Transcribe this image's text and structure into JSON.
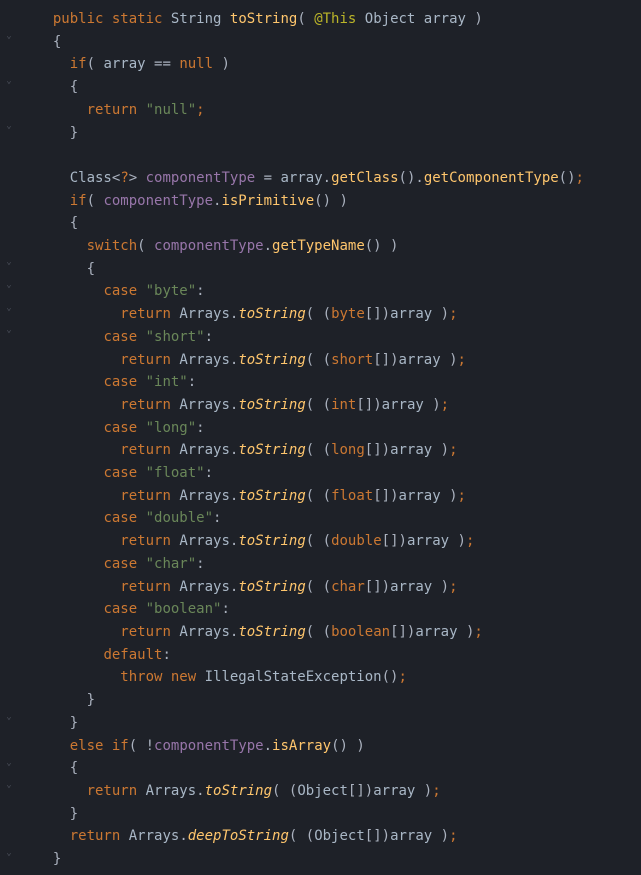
{
  "code": {
    "lines": [
      {
        "indent": 1,
        "tokens": [
          {
            "t": "public ",
            "c": "kw-orange"
          },
          {
            "t": "static ",
            "c": "kw-orange"
          },
          {
            "t": "String ",
            "c": "class-name"
          },
          {
            "t": "toString",
            "c": "method"
          },
          {
            "t": "( ",
            "c": "white"
          },
          {
            "t": "@This ",
            "c": "anno"
          },
          {
            "t": "Object ",
            "c": "class-name"
          },
          {
            "t": "array ",
            "c": "param"
          },
          {
            "t": ")",
            "c": "white"
          }
        ]
      },
      {
        "indent": 1,
        "tokens": [
          {
            "t": "{",
            "c": "white"
          }
        ]
      },
      {
        "indent": 2,
        "tokens": [
          {
            "t": "if",
            "c": "kw-orange"
          },
          {
            "t": "( ",
            "c": "white"
          },
          {
            "t": "array ",
            "c": "param"
          },
          {
            "t": "== ",
            "c": "white"
          },
          {
            "t": "null ",
            "c": "kw-orange"
          },
          {
            "t": ")",
            "c": "white"
          }
        ]
      },
      {
        "indent": 2,
        "tokens": [
          {
            "t": "{",
            "c": "white"
          }
        ]
      },
      {
        "indent": 3,
        "tokens": [
          {
            "t": "return ",
            "c": "kw-orange"
          },
          {
            "t": "\"null\"",
            "c": "str"
          },
          {
            "t": ";",
            "c": "kw-orange"
          }
        ]
      },
      {
        "indent": 2,
        "tokens": [
          {
            "t": "}",
            "c": "white"
          }
        ]
      },
      {
        "indent": 0,
        "tokens": [
          {
            "t": " ",
            "c": "white"
          }
        ]
      },
      {
        "indent": 2,
        "tokens": [
          {
            "t": "Class",
            "c": "class-name"
          },
          {
            "t": "<",
            "c": "white"
          },
          {
            "t": "?",
            "c": "kw-orange"
          },
          {
            "t": "> ",
            "c": "white"
          },
          {
            "t": "componentType ",
            "c": "ident"
          },
          {
            "t": "= ",
            "c": "white"
          },
          {
            "t": "array",
            "c": "param"
          },
          {
            "t": ".",
            "c": "white"
          },
          {
            "t": "getClass",
            "c": "method"
          },
          {
            "t": "().",
            "c": "white"
          },
          {
            "t": "getComponentType",
            "c": "method"
          },
          {
            "t": "()",
            "c": "white"
          },
          {
            "t": ";",
            "c": "kw-orange"
          }
        ]
      },
      {
        "indent": 2,
        "tokens": [
          {
            "t": "if",
            "c": "kw-orange"
          },
          {
            "t": "( ",
            "c": "white"
          },
          {
            "t": "componentType",
            "c": "ident"
          },
          {
            "t": ".",
            "c": "white"
          },
          {
            "t": "isPrimitive",
            "c": "method"
          },
          {
            "t": "() )",
            "c": "white"
          }
        ]
      },
      {
        "indent": 2,
        "tokens": [
          {
            "t": "{",
            "c": "white"
          }
        ]
      },
      {
        "indent": 3,
        "tokens": [
          {
            "t": "switch",
            "c": "kw-orange"
          },
          {
            "t": "( ",
            "c": "white"
          },
          {
            "t": "componentType",
            "c": "ident"
          },
          {
            "t": ".",
            "c": "white"
          },
          {
            "t": "getTypeName",
            "c": "method"
          },
          {
            "t": "() )",
            "c": "white"
          }
        ]
      },
      {
        "indent": 3,
        "tokens": [
          {
            "t": "{",
            "c": "white"
          }
        ]
      },
      {
        "indent": 4,
        "tokens": [
          {
            "t": "case ",
            "c": "kw-orange"
          },
          {
            "t": "\"byte\"",
            "c": "str"
          },
          {
            "t": ":",
            "c": "white"
          }
        ]
      },
      {
        "indent": 5,
        "tokens": [
          {
            "t": "return ",
            "c": "kw-orange"
          },
          {
            "t": "Arrays",
            "c": "class-name"
          },
          {
            "t": ".",
            "c": "white"
          },
          {
            "t": "toString",
            "c": "method-it"
          },
          {
            "t": "( (",
            "c": "white"
          },
          {
            "t": "byte",
            "c": "kw-orange"
          },
          {
            "t": "[])",
            "c": "white"
          },
          {
            "t": "array ",
            "c": "param"
          },
          {
            "t": ")",
            "c": "white"
          },
          {
            "t": ";",
            "c": "kw-orange"
          }
        ]
      },
      {
        "indent": 4,
        "tokens": [
          {
            "t": "case ",
            "c": "kw-orange"
          },
          {
            "t": "\"short\"",
            "c": "str"
          },
          {
            "t": ":",
            "c": "white"
          }
        ]
      },
      {
        "indent": 5,
        "tokens": [
          {
            "t": "return ",
            "c": "kw-orange"
          },
          {
            "t": "Arrays",
            "c": "class-name"
          },
          {
            "t": ".",
            "c": "white"
          },
          {
            "t": "toString",
            "c": "method-it"
          },
          {
            "t": "( (",
            "c": "white"
          },
          {
            "t": "short",
            "c": "kw-orange"
          },
          {
            "t": "[])",
            "c": "white"
          },
          {
            "t": "array ",
            "c": "param"
          },
          {
            "t": ")",
            "c": "white"
          },
          {
            "t": ";",
            "c": "kw-orange"
          }
        ]
      },
      {
        "indent": 4,
        "tokens": [
          {
            "t": "case ",
            "c": "kw-orange"
          },
          {
            "t": "\"int\"",
            "c": "str"
          },
          {
            "t": ":",
            "c": "white"
          }
        ]
      },
      {
        "indent": 5,
        "tokens": [
          {
            "t": "return ",
            "c": "kw-orange"
          },
          {
            "t": "Arrays",
            "c": "class-name"
          },
          {
            "t": ".",
            "c": "white"
          },
          {
            "t": "toString",
            "c": "method-it"
          },
          {
            "t": "( (",
            "c": "white"
          },
          {
            "t": "int",
            "c": "kw-orange"
          },
          {
            "t": "[])",
            "c": "white"
          },
          {
            "t": "array ",
            "c": "param"
          },
          {
            "t": ")",
            "c": "white"
          },
          {
            "t": ";",
            "c": "kw-orange"
          }
        ]
      },
      {
        "indent": 4,
        "tokens": [
          {
            "t": "case ",
            "c": "kw-orange"
          },
          {
            "t": "\"long\"",
            "c": "str"
          },
          {
            "t": ":",
            "c": "white"
          }
        ]
      },
      {
        "indent": 5,
        "tokens": [
          {
            "t": "return ",
            "c": "kw-orange"
          },
          {
            "t": "Arrays",
            "c": "class-name"
          },
          {
            "t": ".",
            "c": "white"
          },
          {
            "t": "toString",
            "c": "method-it"
          },
          {
            "t": "( (",
            "c": "white"
          },
          {
            "t": "long",
            "c": "kw-orange"
          },
          {
            "t": "[])",
            "c": "white"
          },
          {
            "t": "array ",
            "c": "param"
          },
          {
            "t": ")",
            "c": "white"
          },
          {
            "t": ";",
            "c": "kw-orange"
          }
        ]
      },
      {
        "indent": 4,
        "tokens": [
          {
            "t": "case ",
            "c": "kw-orange"
          },
          {
            "t": "\"float\"",
            "c": "str"
          },
          {
            "t": ":",
            "c": "white"
          }
        ]
      },
      {
        "indent": 5,
        "tokens": [
          {
            "t": "return ",
            "c": "kw-orange"
          },
          {
            "t": "Arrays",
            "c": "class-name"
          },
          {
            "t": ".",
            "c": "white"
          },
          {
            "t": "toString",
            "c": "method-it"
          },
          {
            "t": "( (",
            "c": "white"
          },
          {
            "t": "float",
            "c": "kw-orange"
          },
          {
            "t": "[])",
            "c": "white"
          },
          {
            "t": "array ",
            "c": "param"
          },
          {
            "t": ")",
            "c": "white"
          },
          {
            "t": ";",
            "c": "kw-orange"
          }
        ]
      },
      {
        "indent": 4,
        "tokens": [
          {
            "t": "case ",
            "c": "kw-orange"
          },
          {
            "t": "\"double\"",
            "c": "str"
          },
          {
            "t": ":",
            "c": "white"
          }
        ]
      },
      {
        "indent": 5,
        "tokens": [
          {
            "t": "return ",
            "c": "kw-orange"
          },
          {
            "t": "Arrays",
            "c": "class-name"
          },
          {
            "t": ".",
            "c": "white"
          },
          {
            "t": "toString",
            "c": "method-it"
          },
          {
            "t": "( (",
            "c": "white"
          },
          {
            "t": "double",
            "c": "kw-orange"
          },
          {
            "t": "[])",
            "c": "white"
          },
          {
            "t": "array ",
            "c": "param"
          },
          {
            "t": ")",
            "c": "white"
          },
          {
            "t": ";",
            "c": "kw-orange"
          }
        ]
      },
      {
        "indent": 4,
        "tokens": [
          {
            "t": "case ",
            "c": "kw-orange"
          },
          {
            "t": "\"char\"",
            "c": "str"
          },
          {
            "t": ":",
            "c": "white"
          }
        ]
      },
      {
        "indent": 5,
        "tokens": [
          {
            "t": "return ",
            "c": "kw-orange"
          },
          {
            "t": "Arrays",
            "c": "class-name"
          },
          {
            "t": ".",
            "c": "white"
          },
          {
            "t": "toString",
            "c": "method-it"
          },
          {
            "t": "( (",
            "c": "white"
          },
          {
            "t": "char",
            "c": "kw-orange"
          },
          {
            "t": "[])",
            "c": "white"
          },
          {
            "t": "array ",
            "c": "param"
          },
          {
            "t": ")",
            "c": "white"
          },
          {
            "t": ";",
            "c": "kw-orange"
          }
        ]
      },
      {
        "indent": 4,
        "tokens": [
          {
            "t": "case ",
            "c": "kw-orange"
          },
          {
            "t": "\"boolean\"",
            "c": "str"
          },
          {
            "t": ":",
            "c": "white"
          }
        ]
      },
      {
        "indent": 5,
        "tokens": [
          {
            "t": "return ",
            "c": "kw-orange"
          },
          {
            "t": "Arrays",
            "c": "class-name"
          },
          {
            "t": ".",
            "c": "white"
          },
          {
            "t": "toString",
            "c": "method-it"
          },
          {
            "t": "( (",
            "c": "white"
          },
          {
            "t": "boolean",
            "c": "kw-orange"
          },
          {
            "t": "[])",
            "c": "white"
          },
          {
            "t": "array ",
            "c": "param"
          },
          {
            "t": ")",
            "c": "white"
          },
          {
            "t": ";",
            "c": "kw-orange"
          }
        ]
      },
      {
        "indent": 4,
        "tokens": [
          {
            "t": "default",
            "c": "kw-orange"
          },
          {
            "t": ":",
            "c": "white"
          }
        ]
      },
      {
        "indent": 5,
        "tokens": [
          {
            "t": "throw new ",
            "c": "kw-orange"
          },
          {
            "t": "IllegalStateException",
            "c": "class-name"
          },
          {
            "t": "()",
            "c": "white"
          },
          {
            "t": ";",
            "c": "kw-orange"
          }
        ]
      },
      {
        "indent": 3,
        "tokens": [
          {
            "t": "}",
            "c": "white"
          }
        ]
      },
      {
        "indent": 2,
        "tokens": [
          {
            "t": "}",
            "c": "white"
          }
        ]
      },
      {
        "indent": 2,
        "tokens": [
          {
            "t": "else if",
            "c": "kw-orange"
          },
          {
            "t": "( !",
            "c": "white"
          },
          {
            "t": "componentType",
            "c": "ident"
          },
          {
            "t": ".",
            "c": "white"
          },
          {
            "t": "isArray",
            "c": "method"
          },
          {
            "t": "() )",
            "c": "white"
          }
        ]
      },
      {
        "indent": 2,
        "tokens": [
          {
            "t": "{",
            "c": "white"
          }
        ]
      },
      {
        "indent": 3,
        "tokens": [
          {
            "t": "return ",
            "c": "kw-orange"
          },
          {
            "t": "Arrays",
            "c": "class-name"
          },
          {
            "t": ".",
            "c": "white"
          },
          {
            "t": "toString",
            "c": "method-it"
          },
          {
            "t": "( (",
            "c": "white"
          },
          {
            "t": "Object",
            "c": "class-name"
          },
          {
            "t": "[])",
            "c": "white"
          },
          {
            "t": "array ",
            "c": "param"
          },
          {
            "t": ")",
            "c": "white"
          },
          {
            "t": ";",
            "c": "kw-orange"
          }
        ]
      },
      {
        "indent": 2,
        "tokens": [
          {
            "t": "}",
            "c": "white"
          }
        ]
      },
      {
        "indent": 2,
        "tokens": [
          {
            "t": "return ",
            "c": "kw-orange"
          },
          {
            "t": "Arrays",
            "c": "class-name"
          },
          {
            "t": ".",
            "c": "white"
          },
          {
            "t": "deepToString",
            "c": "method-it"
          },
          {
            "t": "( (",
            "c": "white"
          },
          {
            "t": "Object",
            "c": "class-name"
          },
          {
            "t": "[])",
            "c": "white"
          },
          {
            "t": "array ",
            "c": "param"
          },
          {
            "t": ")",
            "c": "white"
          },
          {
            "t": ";",
            "c": "kw-orange"
          }
        ]
      },
      {
        "indent": 1,
        "tokens": [
          {
            "t": "}",
            "c": "white"
          }
        ]
      }
    ]
  },
  "folds": [
    31,
    76,
    121,
    257,
    280,
    303,
    325,
    712,
    758,
    780,
    848
  ]
}
